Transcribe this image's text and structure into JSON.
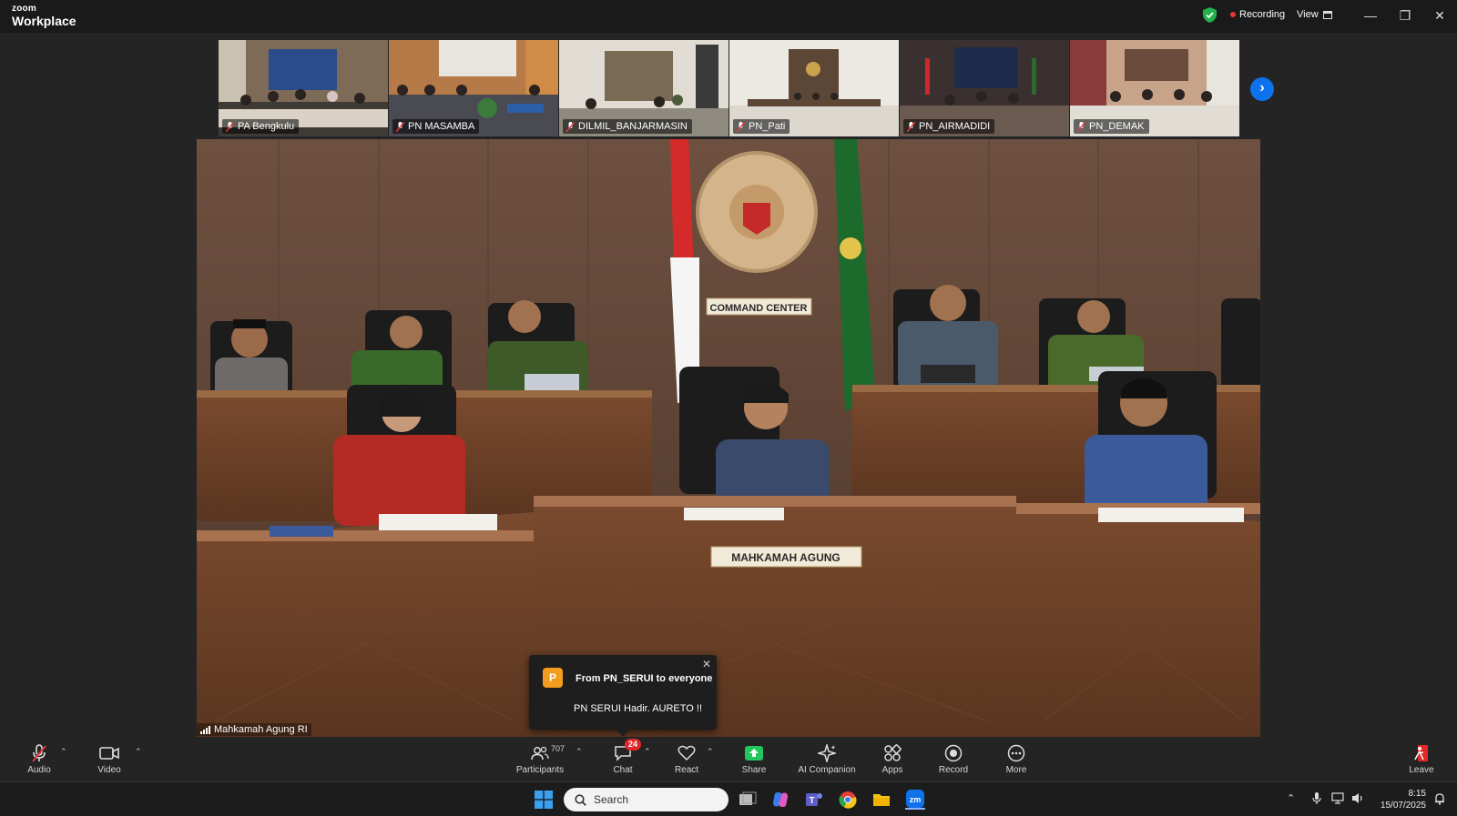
{
  "app": {
    "brand_small": "zoom",
    "brand_large": "Workplace"
  },
  "header": {
    "recording_label": "Recording",
    "view_label": "View"
  },
  "gallery": [
    {
      "name": "PA Bengkulu"
    },
    {
      "name": "PN MASAMBA"
    },
    {
      "name": "DILMIL_BANJARMASIN"
    },
    {
      "name": "PN_Pati"
    },
    {
      "name": "PN_AIRMADIDI"
    },
    {
      "name": "PN_DEMAK"
    }
  ],
  "main_video": {
    "speaker_name": "Mahkamah Agung RI",
    "sign_command": "COMMAND CENTER",
    "sign_desk": "MAHKAMAH AGUNG"
  },
  "chat_toast": {
    "avatar_initial": "P",
    "from": "From PN_SERUI to everyone",
    "message": "PN SERUI Hadir. AURETO !!"
  },
  "toolbar": {
    "audio": "Audio",
    "video": "Video",
    "participants": "Participants",
    "participants_count": "707",
    "chat": "Chat",
    "chat_badge": "24",
    "react": "React",
    "share": "Share",
    "ai_companion": "AI Companion",
    "apps": "Apps",
    "record": "Record",
    "more": "More",
    "leave": "Leave"
  },
  "taskbar": {
    "search_placeholder": "Search",
    "time": "8:15",
    "date": "15/07/2025"
  },
  "colors": {
    "accent_blue": "#0e72ed",
    "recording_red": "#e5383b",
    "share_green": "#23c55e",
    "badge_red": "#e02828",
    "toast_avatar": "#f29d1e"
  }
}
